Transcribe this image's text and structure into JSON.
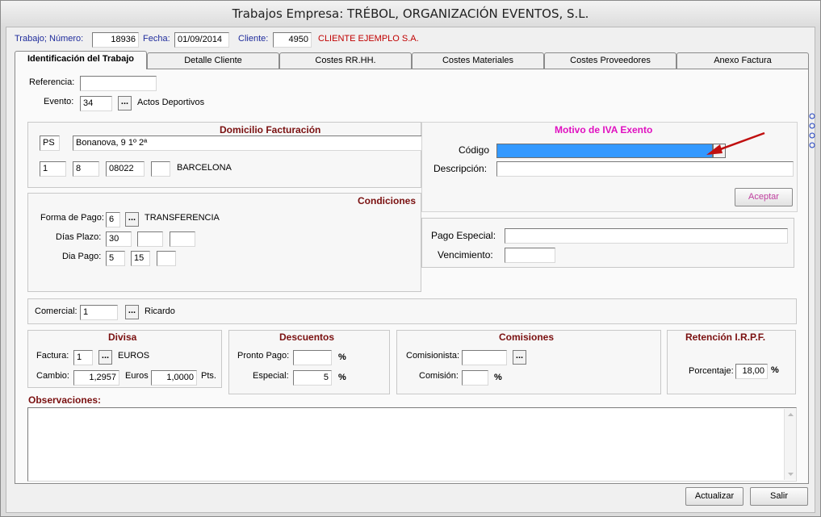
{
  "window": {
    "title": "Trabajos Empresa: TRÉBOL, ORGANIZACIÓN EVENTOS, S.L."
  },
  "header": {
    "trabajo_label": "Trabajo; Número:",
    "trabajo_value": "18936",
    "fecha_label": "Fecha:",
    "fecha_value": "01/09/2014",
    "cliente_label": "Cliente:",
    "cliente_value": "4950",
    "cliente_name": "CLIENTE EJEMPLO S.A."
  },
  "tabs": [
    {
      "label": "Identificación del Trabajo"
    },
    {
      "label": "Detalle Cliente"
    },
    {
      "label": "Costes RR.HH."
    },
    {
      "label": "Costes Materiales"
    },
    {
      "label": "Costes Proveedores"
    },
    {
      "label": "Anexo Factura"
    }
  ],
  "main": {
    "referencia_label": "Referencia:",
    "referencia_value": "",
    "evento_label": "Evento:",
    "evento_value": "34",
    "evento_name": "Actos Deportivos",
    "dots": "...",
    "domicilio": {
      "title": "Domicilio Facturación",
      "via": "PS",
      "direccion": "Bonanova, 9 1º 2ª",
      "f1": "1",
      "f2": "8",
      "cp": "08022",
      "f4": "",
      "ciudad": "BARCELONA"
    },
    "condiciones": {
      "title": "Condiciones",
      "forma_label": "Forma de Pago:",
      "forma_value": "6",
      "forma_name": "TRANSFERENCIA",
      "dias_label": "Días Plazo:",
      "dias_1": "30",
      "dias_2": "",
      "dias_3": "",
      "diapago_label": "Dia Pago:",
      "diapago_1": "5",
      "diapago_2": "15",
      "diapago_3": ""
    },
    "iva": {
      "title": "Motivo de IVA Exento",
      "codigo_label": "Código",
      "descripcion_label": "Descripción:",
      "descripcion_value": "",
      "aceptar_label": "Aceptar"
    },
    "pago_especial_label": "Pago Especial:",
    "pago_especial_value": "",
    "vencimiento_label": "Vencimiento:",
    "vencimiento_value": "",
    "comercial_label": "Comercial:",
    "comercial_value": "1",
    "comercial_name": "Ricardo",
    "divisa": {
      "title": "Divisa",
      "factura_label": "Factura:",
      "factura_value": "1",
      "factura_name": "EUROS",
      "cambio_label": "Cambio:",
      "cambio_value": "1,2957",
      "euros_label": "Euros",
      "euros_value": "1,0000",
      "pts_label": "Pts."
    },
    "descuentos": {
      "title": "Descuentos",
      "pronto_label": "Pronto Pago:",
      "pronto_value": "",
      "especial_label": "Especial:",
      "especial_value": "5",
      "pct": "%"
    },
    "comisiones": {
      "title": "Comisiones",
      "comisionista_label": "Comisionista:",
      "comisionista_value": "",
      "comision_label": "Comisión:",
      "comision_value": "",
      "pct": "%"
    },
    "retencion": {
      "title": "Retención I.R.P.F.",
      "porcentaje_label": "Porcentaje:",
      "porcentaje_value": "18,00",
      "pct": "%"
    },
    "observaciones_label": "Observaciones:",
    "observaciones_value": ""
  },
  "footer": {
    "actualizar_label": "Actualizar",
    "salir_label": "Salir"
  },
  "colors": {
    "iva_title": "#e010c0",
    "group_title": "#7a1010",
    "selection": "#3399ff",
    "arrow": "#c01010"
  }
}
